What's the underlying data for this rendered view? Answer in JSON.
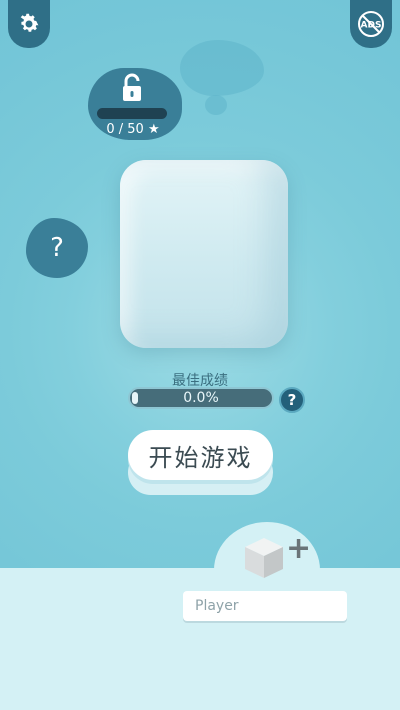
{
  "buttons": {
    "settings_icon": "gear-icon",
    "ads_icon": "no-ads-icon",
    "ads_label": "ADS"
  },
  "unlock": {
    "icon": "lock-icon",
    "stars_text": "0 / 50 ★",
    "progress": 0
  },
  "help": {
    "label": "?"
  },
  "best_score": {
    "label": "最佳成绩",
    "value": "0.0%",
    "progress": 0.0,
    "help_label": "?"
  },
  "start_button": {
    "label": "开始游戏"
  },
  "player": {
    "avatar_icon": "cube-icon",
    "add_icon": "plus-icon",
    "add_label": "+",
    "name_value": "",
    "name_placeholder": "Player"
  },
  "colors": {
    "background": "#7ccbda",
    "dark_button": "#2f6f87",
    "badge": "#3a7f98",
    "panel": "#d4f1f5",
    "start_text": "#3b4b52"
  }
}
